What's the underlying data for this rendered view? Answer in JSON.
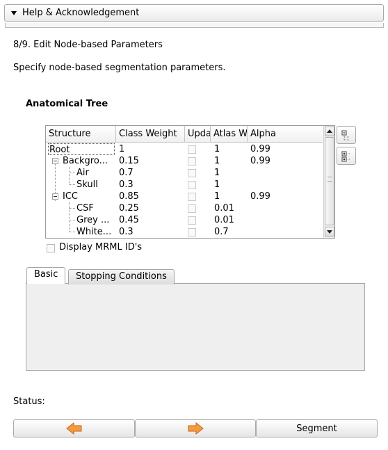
{
  "help": {
    "title": "Help & Acknowledgement"
  },
  "step": {
    "title": "8/9. Edit Node-based Parameters",
    "description": "Specify node-based segmentation parameters."
  },
  "tree": {
    "heading": "Anatomical Tree",
    "columns": [
      "Structure",
      "Class Weight",
      "Upda",
      "Atlas W",
      "Alpha"
    ],
    "rows": [
      {
        "structure": "Root",
        "class_weight": "1",
        "atlas_weight": "1",
        "alpha": "0.99"
      },
      {
        "structure": "Backgro...",
        "class_weight": "0.15",
        "atlas_weight": "1",
        "alpha": "0.99"
      },
      {
        "structure": "Air",
        "class_weight": "0.7",
        "atlas_weight": "1",
        "alpha": ""
      },
      {
        "structure": "Skull",
        "class_weight": "0.3",
        "atlas_weight": "1",
        "alpha": ""
      },
      {
        "structure": "ICC",
        "class_weight": "0.85",
        "atlas_weight": "1",
        "alpha": "0.99"
      },
      {
        "structure": "CSF",
        "class_weight": "0.25",
        "atlas_weight": "0.01",
        "alpha": ""
      },
      {
        "structure": "Grey ...",
        "class_weight": "0.45",
        "atlas_weight": "0.01",
        "alpha": ""
      },
      {
        "structure": "White...",
        "class_weight": "0.3",
        "atlas_weight": "0.7",
        "alpha": ""
      }
    ]
  },
  "display_mrml": {
    "label": "Display MRML ID's",
    "checked": false
  },
  "tabs": [
    {
      "label": "Basic",
      "active": true
    },
    {
      "label": "Stopping Conditions",
      "active": false
    }
  ],
  "status": {
    "label": "Status:"
  },
  "buttons": {
    "back_icon": "arrow-left-icon",
    "next_icon": "arrow-right-icon",
    "segment": "Segment"
  },
  "colors": {
    "arrow_fill": "#f29b3f",
    "arrow_stroke": "#c8651a"
  }
}
